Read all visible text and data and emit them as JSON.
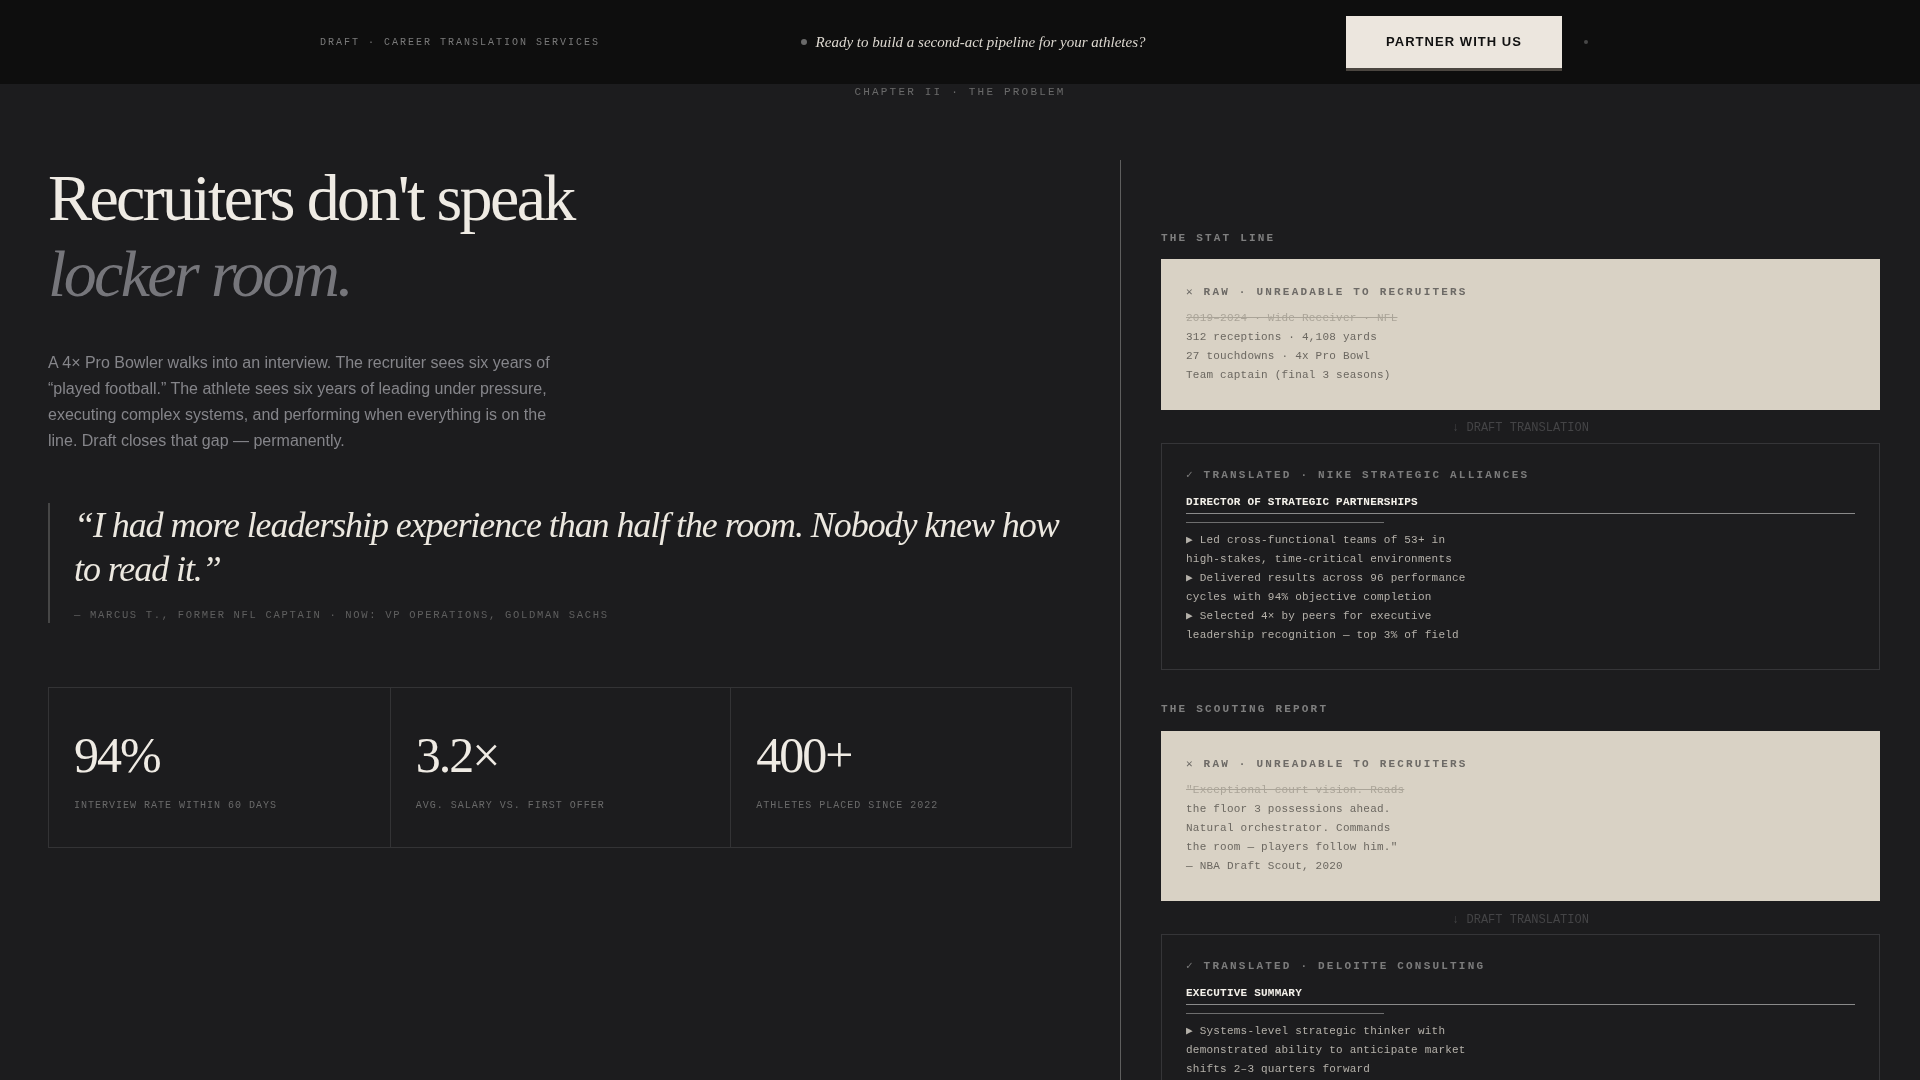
{
  "header": {
    "brand": "DRAFT · CAREER TRANSLATION SERVICES",
    "tagline": "Ready to build a second-act pipeline for your athletes?",
    "cta": "PARTNER WITH US"
  },
  "chapter": "CHAPTER II · THE PROBLEM",
  "hero": {
    "title": "Recruiters don't speak",
    "title_emphasis": "locker room.",
    "body": "A 4× Pro Bowler walks into an interview. The recruiter sees six years of “played football.” The athlete sees six years of leading under pressure, executing complex systems, and performing when everything is on the line. Draft closes that gap — permanently."
  },
  "quote": {
    "text": "“I had more leadership experience than half the room. Nobody knew how to read it.”",
    "attribution": "— MARCUS T., FORMER NFL CAPTAIN · NOW: VP OPERATIONS, GOLDMAN SACHS"
  },
  "stats": [
    {
      "value": "94%",
      "label": "INTERVIEW RATE WITHIN 60 DAYS"
    },
    {
      "value": "3.2×",
      "label": "AVG. SALARY VS. FIRST OFFER"
    },
    {
      "value": "400+",
      "label": "ATHLETES PLACED SINCE 2022"
    }
  ],
  "comparisons": [
    {
      "heading": "THE STAT LINE",
      "raw": {
        "label": "✕ RAW · UNREADABLE TO RECRUITERS",
        "lines": [
          {
            "text": "2019–2024 · Wide Receiver · NFL",
            "struck": true
          },
          {
            "text": "312 receptions · 4,108 yards",
            "struck": false
          },
          {
            "text": "27 touchdowns · 4x Pro Bowl",
            "struck": false
          },
          {
            "text": "Team captain (final 3 seasons)",
            "struck": false
          }
        ]
      },
      "divider": "↓ DRAFT TRANSLATION",
      "translated": {
        "label": "✓ TRANSLATED · NIKE STRATEGIC ALLIANCES",
        "title": "DIRECTOR OF STRATEGIC PARTNERSHIPS",
        "bullets": [
          "▶ Led cross-functional teams of 53+ in high-stakes, time-critical environments",
          "▶ Delivered results across 96 performance cycles with 94% objective completion",
          "▶ Selected 4× by peers for executive leadership recognition — top 3% of field"
        ]
      }
    },
    {
      "heading": "THE SCOUTING REPORT",
      "raw": {
        "label": "✕ RAW · UNREADABLE TO RECRUITERS",
        "lines": [
          {
            "text": "\"Exceptional court vision. Reads",
            "struck": true
          },
          {
            "text": "the floor 3 possessions ahead.",
            "struck": false
          },
          {
            "text": "Natural orchestrator. Commands",
            "struck": false
          },
          {
            "text": "the room — players follow him.\"",
            "struck": false
          },
          {
            "text": "— NBA Draft Scout, 2020",
            "struck": false
          }
        ]
      },
      "divider": "↓ DRAFT TRANSLATION",
      "translated": {
        "label": "✓ TRANSLATED · DELOITTE CONSULTING",
        "title": "EXECUTIVE SUMMARY",
        "bullets": [
          "▶ Systems-level strategic thinker with demonstrated ability to anticipate market shifts 2–3 quarters forward"
        ]
      }
    }
  ]
}
